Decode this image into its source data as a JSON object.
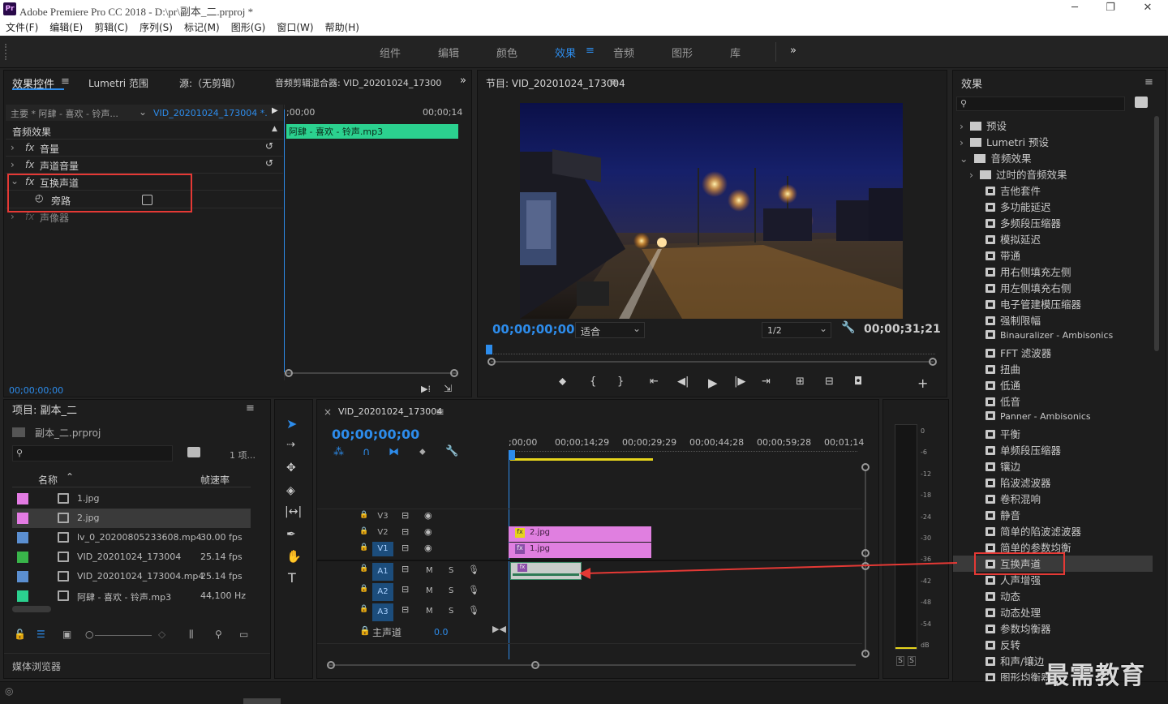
{
  "window": {
    "app_icon": "Pr",
    "title": "Adobe Premiere Pro CC 2018 - D:\\pr\\副本_二.prproj *",
    "controls": [
      "─",
      "❐",
      "✕"
    ]
  },
  "menu": [
    "文件(F)",
    "编辑(E)",
    "剪辑(C)",
    "序列(S)",
    "标记(M)",
    "图形(G)",
    "窗口(W)",
    "帮助(H)"
  ],
  "workspaces": {
    "tabs": [
      "组件",
      "编辑",
      "颜色",
      "效果",
      "音频",
      "图形",
      "库"
    ],
    "active": "效果",
    "more": "»"
  },
  "effect_controls": {
    "tabs": [
      "效果控件",
      "Lumetri 范围",
      "源:（无剪辑）",
      "音频剪辑混合器: VID_20201024_17300"
    ],
    "source_label": "主要 * 阿肆 - 喜欢 - 铃声...",
    "sequence_label": "VID_20201024_173004 *...",
    "ruler_start": ";00;00",
    "ruler_end": "00;00;14",
    "clip_name": "阿肆 - 喜欢 - 铃声.mp3",
    "section": "音频效果",
    "effects": [
      "音量",
      "声道音量",
      "互换声道",
      "声像器"
    ],
    "param": "旁路",
    "timecode": "00;00;00;00"
  },
  "program_monitor": {
    "title": "节目: VID_20201024_173004",
    "timecode": "00;00;00;00",
    "fit": "适合",
    "resolution": "1/2",
    "duration": "00;00;31;21"
  },
  "effects_panel": {
    "title": "效果",
    "search_placeholder": "",
    "folders": [
      "预设",
      "Lumetri 预设",
      "音频效果",
      "过时的音频效果"
    ],
    "items": [
      "吉他套件",
      "多功能延迟",
      "多频段压缩器",
      "模拟延迟",
      "带通",
      "用右侧填充左侧",
      "用左侧填充右侧",
      "电子管建模压缩器",
      "强制限幅",
      "Binauralizer - Ambisonics",
      "FFT 滤波器",
      "扭曲",
      "低通",
      "低音",
      "Panner - Ambisonics",
      "平衡",
      "单频段压缩器",
      "镶边",
      "陷波滤波器",
      "卷积混响",
      "静音",
      "简单的陷波滤波器",
      "简单的参数均衡",
      "互换声道",
      "人声增强",
      "动态",
      "动态处理",
      "参数均衡器",
      "反转",
      "和声/镶边",
      "图形均衡器"
    ],
    "highlighted": "互换声道"
  },
  "project": {
    "title": "项目: 副本_二",
    "file": "副本_二.prproj",
    "count": "1 项...",
    "col_name": "名称",
    "col_rate": "帧速率",
    "rows": [
      {
        "name": "1.jpg",
        "rate": "",
        "color": "#e37be3"
      },
      {
        "name": "2.jpg",
        "rate": "",
        "color": "#e37be3"
      },
      {
        "name": "lv_0_20200805233608.mp4",
        "rate": "30.00 fps",
        "color": "#5b8fd1"
      },
      {
        "name": "VID_20201024_173004",
        "rate": "25.14 fps",
        "color": "#39b54a"
      },
      {
        "name": "VID_20201024_173004.mp4",
        "rate": "25.14 fps",
        "color": "#5b8fd1"
      },
      {
        "name": "阿肆 - 喜欢 - 铃声.mp3",
        "rate": "44,100 Hz",
        "color": "#2bd18f"
      }
    ],
    "media_browser": "媒体浏览器"
  },
  "timeline": {
    "title": "VID_20201024_173004",
    "timecode": "00;00;00;00",
    "ruler": [
      ";00;00",
      "00;00;14;29",
      "00;00;29;29",
      "00;00;44;28",
      "00;00;59;28",
      "00;01;14"
    ],
    "tracks_video": [
      "V3",
      "V2",
      "V1"
    ],
    "tracks_audio": [
      "A1",
      "A2",
      "A3"
    ],
    "master": "主声道",
    "master_value": "0.0",
    "clips": {
      "v2": "2.jpg",
      "v1": "1.jpg"
    }
  },
  "meter": {
    "scale": [
      "0",
      "-6",
      "-12",
      "-18",
      "-24",
      "-30",
      "-36",
      "-42",
      "-48",
      "-54",
      "dB"
    ],
    "solo": [
      "S",
      "S"
    ]
  },
  "watermark": "最需教育",
  "colors": {
    "accent": "#2d8ceb",
    "audio_clip": "#2bd18f",
    "video_clip": "#e07fe0",
    "highlight": "#e53935"
  }
}
